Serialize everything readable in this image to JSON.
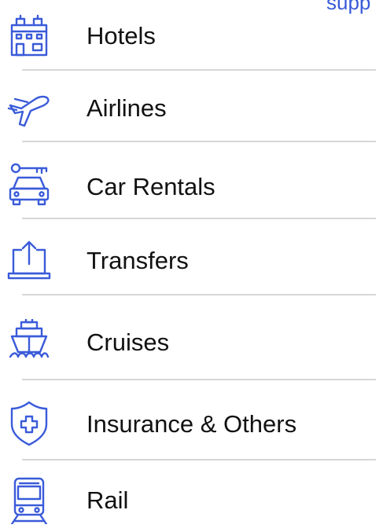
{
  "top_link": "supp",
  "accent_color": "#3a5bd9",
  "menu": {
    "items": [
      {
        "label": "Hotels",
        "icon": "hotel-icon"
      },
      {
        "label": "Airlines",
        "icon": "airplane-icon"
      },
      {
        "label": "Car Rentals",
        "icon": "car-key-icon"
      },
      {
        "label": "Transfers",
        "icon": "laptop-upload-icon"
      },
      {
        "label": "Cruises",
        "icon": "ship-icon"
      },
      {
        "label": "Insurance & Others",
        "icon": "shield-plus-icon"
      },
      {
        "label": "Rail",
        "icon": "train-icon"
      }
    ]
  }
}
